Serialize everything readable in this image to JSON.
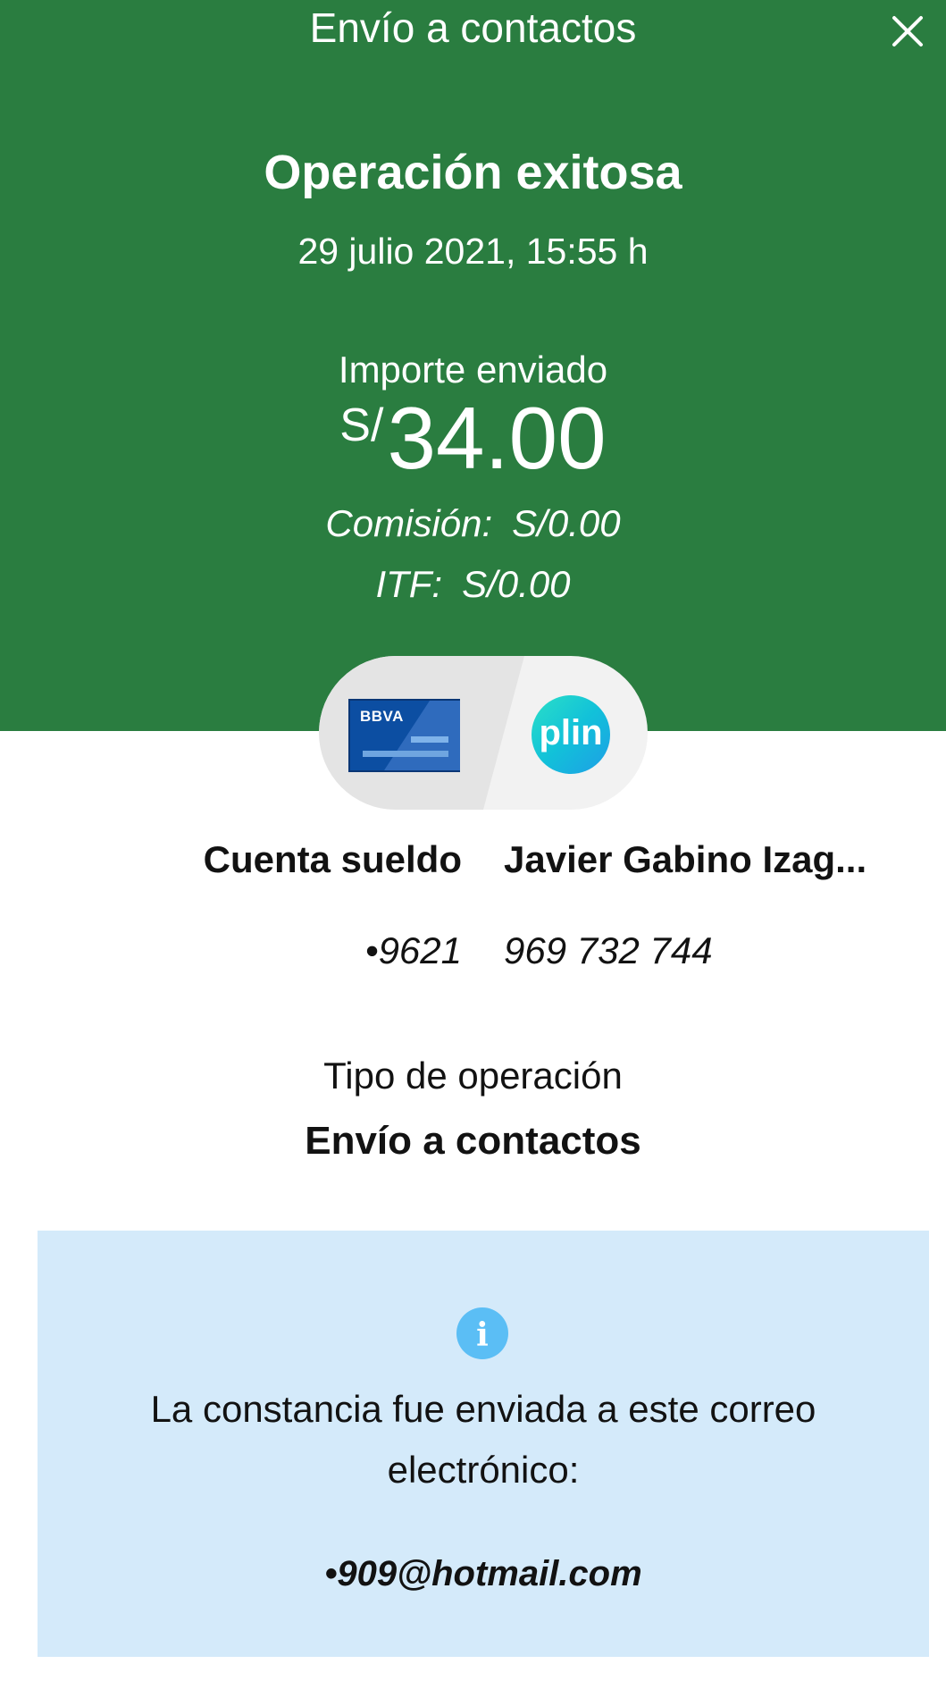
{
  "header": {
    "title": "Envío a contactos",
    "close_icon": "close-icon"
  },
  "result": {
    "title": "Operación exitosa",
    "datetime": "29 julio 2021, 15:55 h",
    "amount_label": "Importe enviado",
    "currency": "S/",
    "amount": "34.00",
    "commission_label": "Comisión:",
    "commission_value": "S/0.00",
    "itf_label": "ITF:",
    "itf_value": "S/0.00"
  },
  "transfer": {
    "origin_brand": "BBVA",
    "origin_name": "Cuenta sueldo",
    "origin_number": "•9621",
    "destination_brand": "plin",
    "destination_name": "Javier Gabino Izag...",
    "destination_number": "969 732 744"
  },
  "operation": {
    "type_label": "Tipo de operación",
    "type_value": "Envío a contactos"
  },
  "notice": {
    "icon": "info-icon",
    "text": "La constancia fue enviada a este correo electrónico:",
    "email": "•909@hotmail.com"
  },
  "colors": {
    "header_green": "#2a7d40",
    "info_background": "#d4eafa",
    "info_icon": "#5bbef5"
  }
}
